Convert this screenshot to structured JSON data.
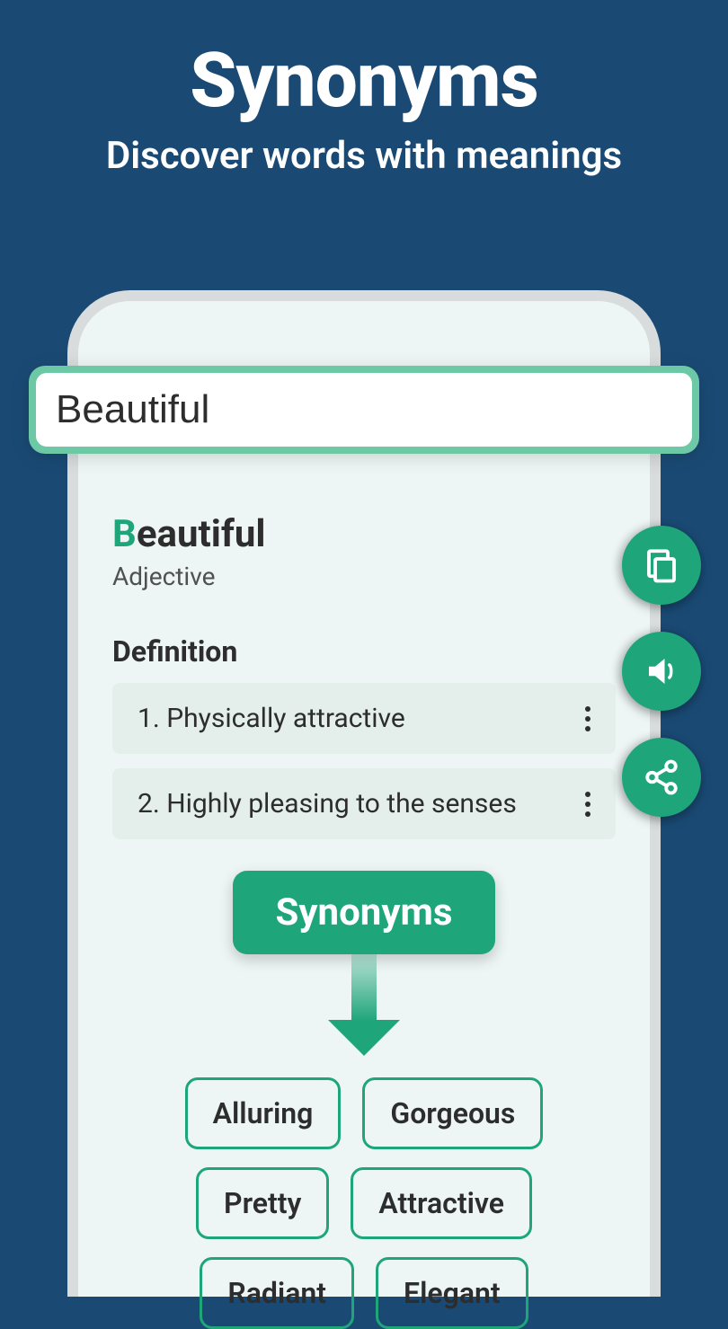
{
  "header": {
    "title": "Synonyms",
    "subtitle": "Discover words with meanings"
  },
  "search": {
    "value": "Beautiful"
  },
  "word": {
    "first_letter": "B",
    "rest": "eautiful",
    "pos": "Adjective",
    "definition_label": "Definition",
    "definitions": [
      "1. Physically attractive",
      "2. Highly pleasing to the senses"
    ]
  },
  "synonyms_label": "Synonyms",
  "synonyms": [
    "Alluring",
    "Gorgeous",
    "Pretty",
    "Attractive",
    "Radiant",
    "Elegant"
  ],
  "colors": {
    "accent": "#1ea579",
    "background": "#1a4a74"
  }
}
